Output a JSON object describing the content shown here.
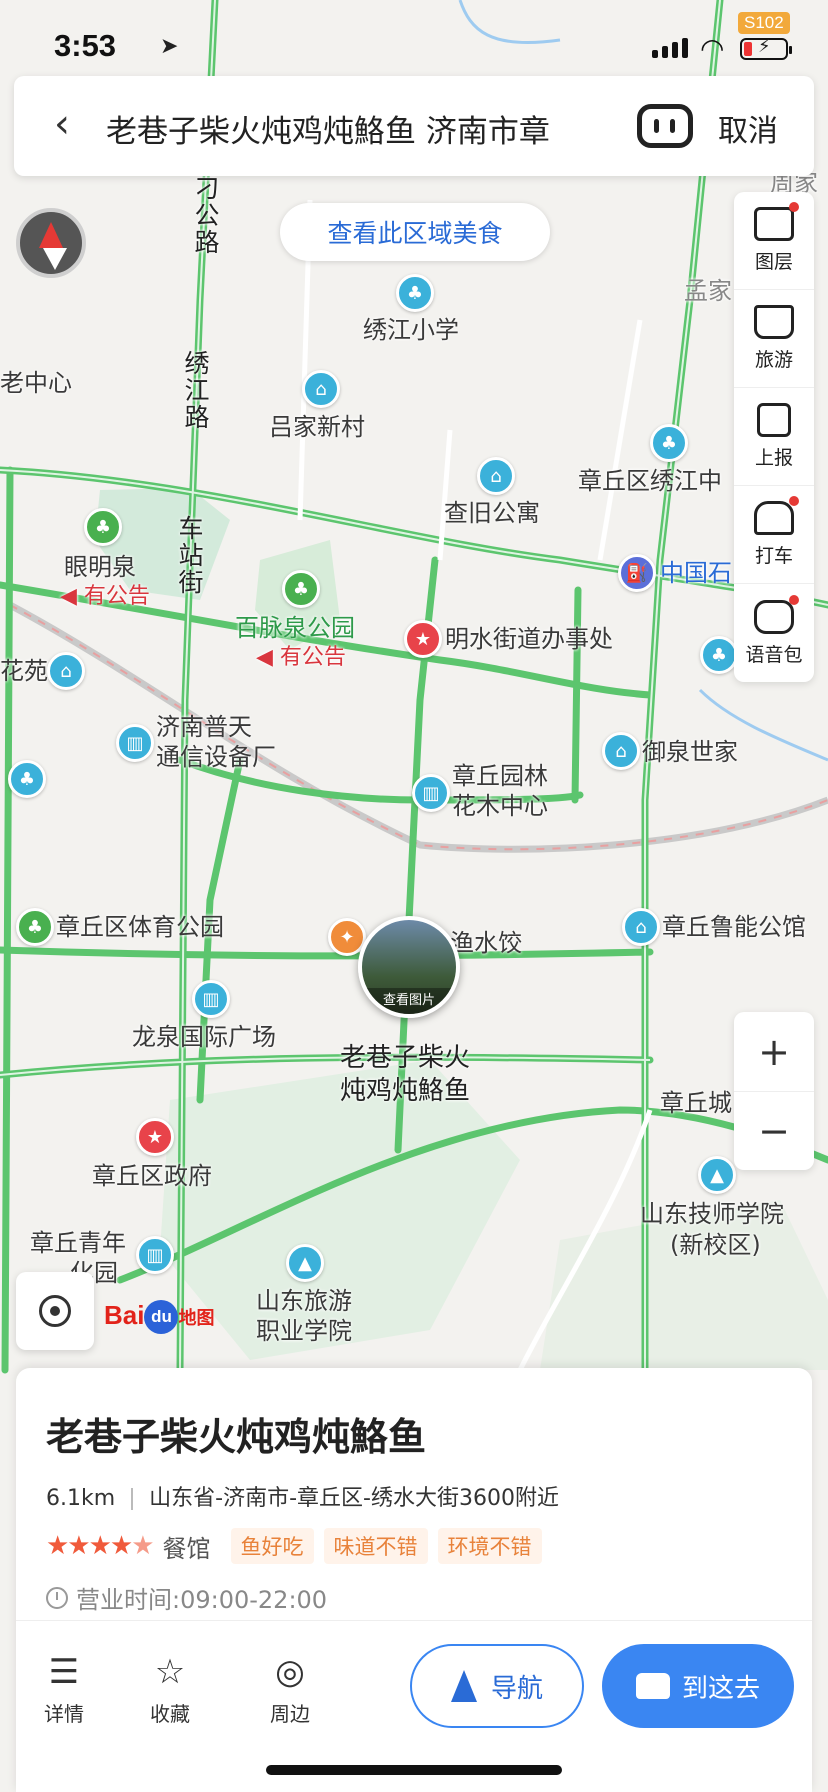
{
  "status_bar": {
    "time": "3:53",
    "road_tag": "S102"
  },
  "search": {
    "query": "老巷子柴火炖鸡炖鮥鱼 济南市章",
    "cancel_label": "取消"
  },
  "area_food_label": "查看此区域美食",
  "tools": [
    {
      "label": "图层",
      "icon": "layers-icon",
      "badge": true
    },
    {
      "label": "旅游",
      "icon": "travel-icon",
      "badge": false
    },
    {
      "label": "上报",
      "icon": "report-icon",
      "badge": false
    },
    {
      "label": "打车",
      "icon": "taxi-icon",
      "badge": true
    },
    {
      "label": "语音包",
      "icon": "voice-pack-icon",
      "badge": true
    }
  ],
  "zoom": {
    "in": "+",
    "out": "−"
  },
  "baidu": {
    "bai": "Bai",
    "du": "du",
    "map": "地图"
  },
  "map_labels": {
    "road_1": "刁公路",
    "road_2": "绣江路",
    "road_3": "车站街",
    "xiujiang_school": "绣江小学",
    "lvjia": "吕家新村",
    "chajiu": "查旧公寓",
    "zhangqiu_xiujiang": "章丘区绣江中",
    "yanmingquan": "眼明泉",
    "notice_1": "有公告",
    "baimai": "百脉泉公园",
    "notice_2": "有公告",
    "mingshui": "明水街道办事处",
    "sinopec": "中国石",
    "huayuan": "花苑",
    "putian_1": "济南普天",
    "putian_2": "通信设备厂",
    "yuanlin_1": "章丘园林",
    "yuanlin_2": "花木中心",
    "yuquan": "御泉世家",
    "sports_park": "章丘区体育公园",
    "dumpling": "渔水饺",
    "luneng": "章丘鲁能公馆",
    "longquan": "龙泉国际广场",
    "target_1": "老巷子柴火",
    "target_2": "炖鸡炖鮥鱼",
    "zhangqiu_city": "章丘城",
    "gov": "章丘区政府",
    "jishi_1": "山东技师学院",
    "jishi_2": "(新校区)",
    "youth_1": "章丘青年",
    "youth_2": "化园",
    "tourism_1": "山东旅游",
    "tourism_2": "职业学院",
    "elder": "老中心",
    "mengjia": "孟家",
    "zhoujia": "周家"
  },
  "photo_caption": "查看图片",
  "place": {
    "name": "老巷子柴火炖鸡炖鮥鱼",
    "distance": "6.1km",
    "address": "山东省-济南市-章丘区-绣水大街3600附近",
    "rating": 4.5,
    "category": "餐馆",
    "tags": [
      "鱼好吃",
      "味道不错",
      "环境不错"
    ],
    "hours": "营业时间:09:00-22:00"
  },
  "actions": {
    "details": "详情",
    "favorite": "收藏",
    "nearby": "周边",
    "navigate": "导航",
    "go_here": "到这去"
  },
  "colors": {
    "road_green": "#5cc56e",
    "accent_blue": "#3a86f2",
    "star_red": "#f05a3b",
    "tag_orange": "#e8823a"
  }
}
